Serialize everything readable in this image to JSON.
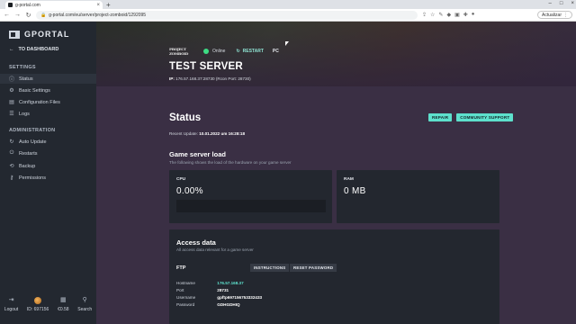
{
  "browser": {
    "tab_title": "g-portal.com",
    "url": "g-portal.com/eu/server/project-zomboid/1292095",
    "update_label": "Actualizar"
  },
  "sidebar": {
    "logo": "GPORTAL",
    "to_dashboard": "TO DASHBOARD",
    "settings_title": "SETTINGS",
    "settings_items": [
      {
        "label": "Status",
        "icon": "info-icon",
        "active": true
      },
      {
        "label": "Basic Settings",
        "icon": "gear-icon"
      },
      {
        "label": "Configuration Files",
        "icon": "file-icon"
      },
      {
        "label": "Logs",
        "icon": "list-icon"
      }
    ],
    "administration_title": "ADMINISTRATION",
    "admin_items": [
      {
        "label": "Auto Update",
        "icon": "refresh-icon"
      },
      {
        "label": "Restarts",
        "icon": "power-icon"
      },
      {
        "label": "Backup",
        "icon": "backup-icon"
      },
      {
        "label": "Permissions",
        "icon": "key-icon"
      }
    ],
    "footer": [
      {
        "label": "Logout",
        "icon": "logout-icon"
      },
      {
        "label": "ID: 697156",
        "icon": "avatar"
      },
      {
        "label": "€0.58",
        "icon": "wallet-icon"
      },
      {
        "label": "Search",
        "icon": "search-icon"
      }
    ]
  },
  "server": {
    "game_logo": "PROJECT ZOMBOID",
    "state": "Online",
    "restart_label": "RESTART",
    "platform": "PC",
    "name": "TEST SERVER",
    "ip_label": "IP:",
    "ip_value": "176.57.168.37:28730 (Rcon Port: 28730)"
  },
  "status": {
    "title": "Status",
    "repair_label": "REPAIR",
    "support_label": "COMMUNITY SUPPORT",
    "recent_label": "Recent Update:",
    "recent_value": "10.01.2022 um 16:28:18"
  },
  "load": {
    "title": "Game server load",
    "subtitle": "The following shows the load of the hardware on your game server",
    "cpu_label": "CPU",
    "cpu_value": "0.00%",
    "cpu_fraction": 0.0,
    "ram_label": "RAM",
    "ram_value": "0 MB"
  },
  "access": {
    "title": "Access data",
    "subtitle": "All access data relevant for a game server",
    "ftp_label": "FTP",
    "instructions_label": "INSTRUCTIONS",
    "reset_label": "RESET PASSWORD",
    "rows": [
      {
        "key": "Hostname",
        "value": "176.57.168.37"
      },
      {
        "key": "Port",
        "value": "28731"
      },
      {
        "key": "Username",
        "value": "gpftp697156753332433"
      },
      {
        "key": "Password",
        "value": "GDHGDHIQ"
      }
    ]
  },
  "colors": {
    "accent": "#5de0cc",
    "online": "#3ddc84",
    "sidebar": "#232830",
    "content": "#3a2f44"
  }
}
